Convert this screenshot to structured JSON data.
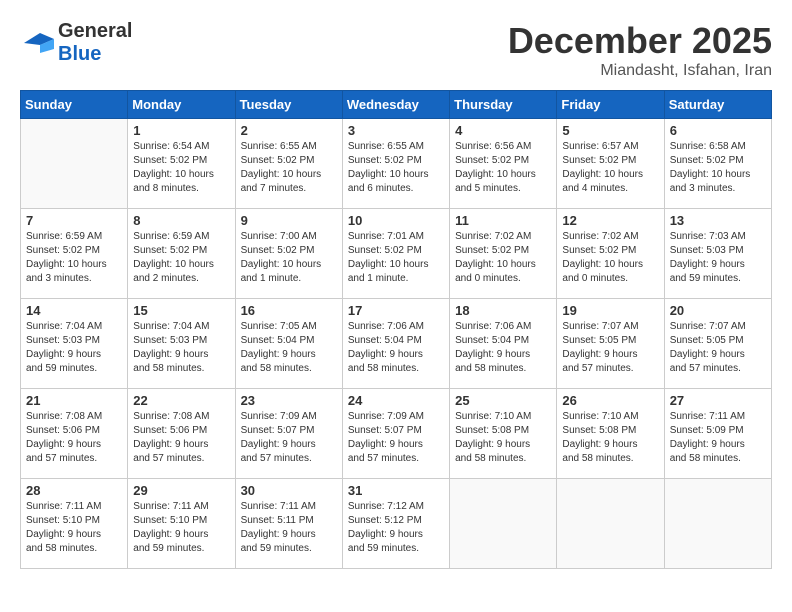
{
  "header": {
    "logo_general": "General",
    "logo_blue": "Blue",
    "month": "December 2025",
    "location": "Miandasht, Isfahan, Iran"
  },
  "days_of_week": [
    "Sunday",
    "Monday",
    "Tuesday",
    "Wednesday",
    "Thursday",
    "Friday",
    "Saturday"
  ],
  "weeks": [
    [
      {
        "day": "",
        "info": ""
      },
      {
        "day": "1",
        "info": "Sunrise: 6:54 AM\nSunset: 5:02 PM\nDaylight: 10 hours\nand 8 minutes."
      },
      {
        "day": "2",
        "info": "Sunrise: 6:55 AM\nSunset: 5:02 PM\nDaylight: 10 hours\nand 7 minutes."
      },
      {
        "day": "3",
        "info": "Sunrise: 6:55 AM\nSunset: 5:02 PM\nDaylight: 10 hours\nand 6 minutes."
      },
      {
        "day": "4",
        "info": "Sunrise: 6:56 AM\nSunset: 5:02 PM\nDaylight: 10 hours\nand 5 minutes."
      },
      {
        "day": "5",
        "info": "Sunrise: 6:57 AM\nSunset: 5:02 PM\nDaylight: 10 hours\nand 4 minutes."
      },
      {
        "day": "6",
        "info": "Sunrise: 6:58 AM\nSunset: 5:02 PM\nDaylight: 10 hours\nand 3 minutes."
      }
    ],
    [
      {
        "day": "7",
        "info": "Sunrise: 6:59 AM\nSunset: 5:02 PM\nDaylight: 10 hours\nand 3 minutes."
      },
      {
        "day": "8",
        "info": "Sunrise: 6:59 AM\nSunset: 5:02 PM\nDaylight: 10 hours\nand 2 minutes."
      },
      {
        "day": "9",
        "info": "Sunrise: 7:00 AM\nSunset: 5:02 PM\nDaylight: 10 hours\nand 1 minute."
      },
      {
        "day": "10",
        "info": "Sunrise: 7:01 AM\nSunset: 5:02 PM\nDaylight: 10 hours\nand 1 minute."
      },
      {
        "day": "11",
        "info": "Sunrise: 7:02 AM\nSunset: 5:02 PM\nDaylight: 10 hours\nand 0 minutes."
      },
      {
        "day": "12",
        "info": "Sunrise: 7:02 AM\nSunset: 5:02 PM\nDaylight: 10 hours\nand 0 minutes."
      },
      {
        "day": "13",
        "info": "Sunrise: 7:03 AM\nSunset: 5:03 PM\nDaylight: 9 hours\nand 59 minutes."
      }
    ],
    [
      {
        "day": "14",
        "info": "Sunrise: 7:04 AM\nSunset: 5:03 PM\nDaylight: 9 hours\nand 59 minutes."
      },
      {
        "day": "15",
        "info": "Sunrise: 7:04 AM\nSunset: 5:03 PM\nDaylight: 9 hours\nand 58 minutes."
      },
      {
        "day": "16",
        "info": "Sunrise: 7:05 AM\nSunset: 5:04 PM\nDaylight: 9 hours\nand 58 minutes."
      },
      {
        "day": "17",
        "info": "Sunrise: 7:06 AM\nSunset: 5:04 PM\nDaylight: 9 hours\nand 58 minutes."
      },
      {
        "day": "18",
        "info": "Sunrise: 7:06 AM\nSunset: 5:04 PM\nDaylight: 9 hours\nand 58 minutes."
      },
      {
        "day": "19",
        "info": "Sunrise: 7:07 AM\nSunset: 5:05 PM\nDaylight: 9 hours\nand 57 minutes."
      },
      {
        "day": "20",
        "info": "Sunrise: 7:07 AM\nSunset: 5:05 PM\nDaylight: 9 hours\nand 57 minutes."
      }
    ],
    [
      {
        "day": "21",
        "info": "Sunrise: 7:08 AM\nSunset: 5:06 PM\nDaylight: 9 hours\nand 57 minutes."
      },
      {
        "day": "22",
        "info": "Sunrise: 7:08 AM\nSunset: 5:06 PM\nDaylight: 9 hours\nand 57 minutes."
      },
      {
        "day": "23",
        "info": "Sunrise: 7:09 AM\nSunset: 5:07 PM\nDaylight: 9 hours\nand 57 minutes."
      },
      {
        "day": "24",
        "info": "Sunrise: 7:09 AM\nSunset: 5:07 PM\nDaylight: 9 hours\nand 57 minutes."
      },
      {
        "day": "25",
        "info": "Sunrise: 7:10 AM\nSunset: 5:08 PM\nDaylight: 9 hours\nand 58 minutes."
      },
      {
        "day": "26",
        "info": "Sunrise: 7:10 AM\nSunset: 5:08 PM\nDaylight: 9 hours\nand 58 minutes."
      },
      {
        "day": "27",
        "info": "Sunrise: 7:11 AM\nSunset: 5:09 PM\nDaylight: 9 hours\nand 58 minutes."
      }
    ],
    [
      {
        "day": "28",
        "info": "Sunrise: 7:11 AM\nSunset: 5:10 PM\nDaylight: 9 hours\nand 58 minutes."
      },
      {
        "day": "29",
        "info": "Sunrise: 7:11 AM\nSunset: 5:10 PM\nDaylight: 9 hours\nand 59 minutes."
      },
      {
        "day": "30",
        "info": "Sunrise: 7:11 AM\nSunset: 5:11 PM\nDaylight: 9 hours\nand 59 minutes."
      },
      {
        "day": "31",
        "info": "Sunrise: 7:12 AM\nSunset: 5:12 PM\nDaylight: 9 hours\nand 59 minutes."
      },
      {
        "day": "",
        "info": ""
      },
      {
        "day": "",
        "info": ""
      },
      {
        "day": "",
        "info": ""
      }
    ]
  ]
}
